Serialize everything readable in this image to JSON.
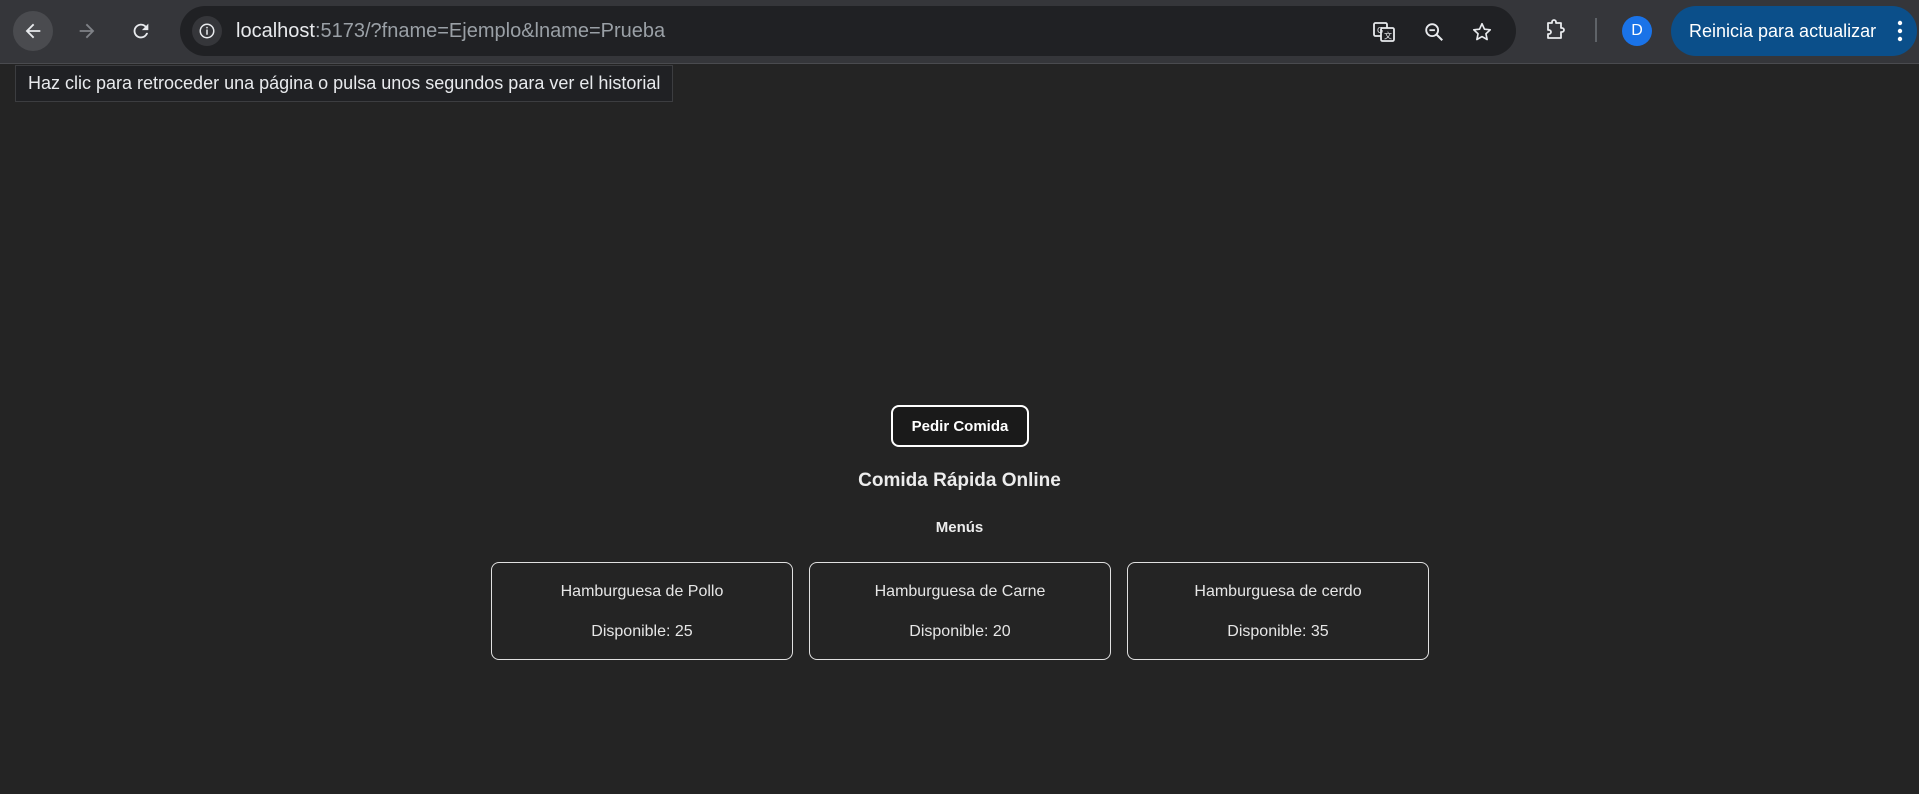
{
  "browser": {
    "url_host": "localhost",
    "url_rest": ":5173/?fname=Ejemplo&lname=Prueba",
    "profile_initial": "D",
    "update_label": "Reinicia para actualizar",
    "back_tooltip": "Haz clic para retroceder una página o pulsa unos segundos para ver el historial",
    "icons": [
      "back-arrow-icon",
      "forward-arrow-icon",
      "reload-icon",
      "site-info-icon",
      "translate-icon",
      "zoom-icon",
      "bookmark-star-icon",
      "extensions-icon",
      "more-vert-icon"
    ]
  },
  "app": {
    "order_button": "Pedir Comida",
    "title": "Comida Rápida Online",
    "menus_heading": "Menús",
    "menus": [
      {
        "name": "Hamburguesa de Pollo",
        "available": "Disponible: 25"
      },
      {
        "name": "Hamburguesa de Carne",
        "available": "Disponible: 20"
      },
      {
        "name": "Hamburguesa de cerdo",
        "available": "Disponible: 35"
      }
    ]
  },
  "colors": {
    "page_background": "#242424",
    "toolbar_background": "#35363a",
    "update_button": "#0b4f8a",
    "avatar": "#1a73e8"
  }
}
